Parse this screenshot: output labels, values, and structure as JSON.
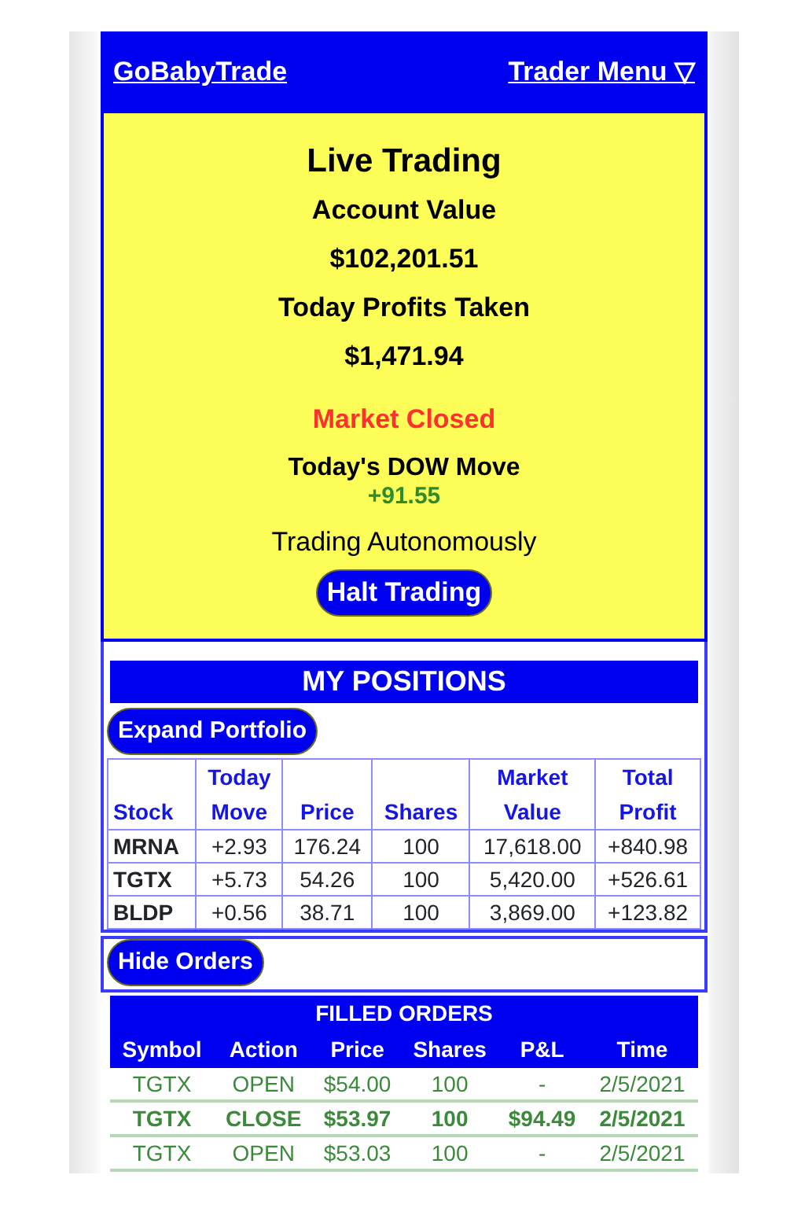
{
  "header": {
    "brand": "GoBabyTrade",
    "menu": "Trader Menu ▽"
  },
  "summary": {
    "title": "Live Trading",
    "account_label": "Account Value",
    "account_value": "$102,201.51",
    "profits_label": "Today Profits Taken",
    "profits_value": "$1,471.94",
    "market_status": "Market Closed",
    "dow_label": "Today's DOW Move",
    "dow_value": "+91.55",
    "mode": "Trading Autonomously",
    "halt_button": "Halt Trading"
  },
  "positions": {
    "title": "MY POSITIONS",
    "expand_button": "Expand Portfolio",
    "columns": [
      "Stock",
      "Today Move",
      "Price",
      "Shares",
      "Market Value",
      "Total Profit"
    ],
    "rows": [
      [
        "MRNA",
        "+2.93",
        "176.24",
        "100",
        "17,618.00",
        "+840.98"
      ],
      [
        "TGTX",
        "+5.73",
        "54.26",
        "100",
        "5,420.00",
        "+526.61"
      ],
      [
        "BLDP",
        "+0.56",
        "38.71",
        "100",
        "3,869.00",
        "+123.82"
      ]
    ]
  },
  "orders": {
    "hide_button": "Hide Orders",
    "title": "FILLED ORDERS",
    "columns": [
      "Symbol",
      "Action",
      "Price",
      "Shares",
      "P&L",
      "Time"
    ],
    "rows": [
      {
        "bold": false,
        "cells": [
          "TGTX",
          "OPEN",
          "$54.00",
          "100",
          "-",
          "2/5/2021"
        ]
      },
      {
        "bold": true,
        "cells": [
          "TGTX",
          "CLOSE",
          "$53.97",
          "100",
          "$94.49",
          "2/5/2021"
        ]
      },
      {
        "bold": false,
        "cells": [
          "TGTX",
          "OPEN",
          "$53.03",
          "100",
          "-",
          "2/5/2021"
        ]
      }
    ]
  }
}
